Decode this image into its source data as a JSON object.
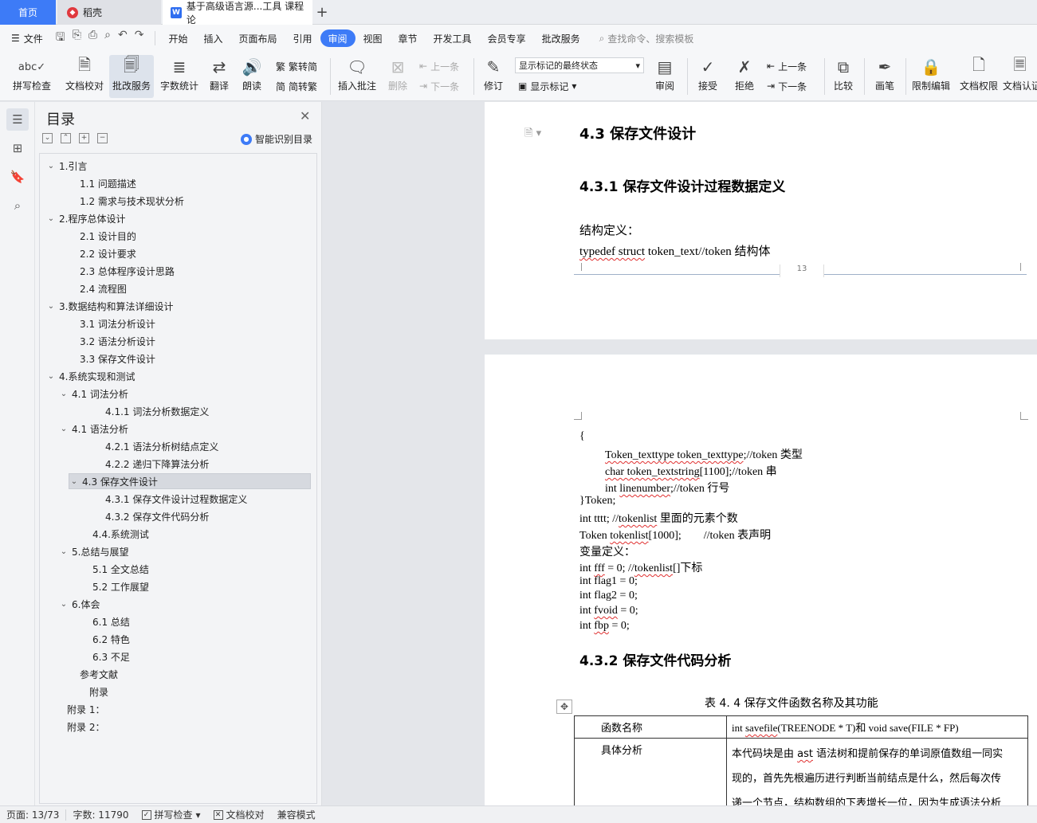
{
  "tabs": {
    "home": "首页",
    "daoke": "稻壳",
    "doc": "基于高级语言源...工具 课程论",
    "new": "+"
  },
  "menu": {
    "file": "文件",
    "items": [
      "开始",
      "插入",
      "页面布局",
      "引用",
      "审阅",
      "视图",
      "章节",
      "开发工具",
      "会员专享",
      "批改服务"
    ],
    "active": "审阅",
    "search": "查找命令、搜索模板"
  },
  "ribbon": {
    "spell": "拼写检查",
    "proof": "文档校对",
    "review_service": "批改服务",
    "wordcount": "字数统计",
    "translate": "翻译",
    "read": "朗读",
    "trad": "繁转简",
    "simp": "简转繁",
    "insert_comment": "插入批注",
    "delete": "删除",
    "prev1": "上一条",
    "next1": "下一条",
    "track": "修订",
    "markup_state": "显示标记的最终状态",
    "show_markup": "显示标记",
    "review_pane": "审阅",
    "accept": "接受",
    "reject": "拒绝",
    "prev2": "上一条",
    "next2": "下一条",
    "compare": "比较",
    "pen": "画笔",
    "restrict": "限制编辑",
    "perm": "文档权限",
    "cert": "文档认证"
  },
  "toc": {
    "title": "目录",
    "smart": "智能识别目录",
    "items": [
      "1.引言",
      "1.1 问题描述",
      "1.2 需求与技术现状分析",
      "2.程序总体设计",
      "2.1 设计目的",
      "2.2 设计要求",
      "2.3 总体程序设计思路",
      "2.4 流程图",
      "3.数据结构和算法详细设计",
      "3.1 词法分析设计",
      "3.2 语法分析设计",
      "3.3 保存文件设计",
      "4.系统实现和测试",
      "4.1 词法分析",
      "4.1.1 词法分析数据定义",
      "4.1 语法分析",
      "4.2.1 语法分析树结点定义",
      "4.2.2 递归下降算法分析",
      "4.3 保存文件设计",
      "4.3.1 保存文件设计过程数据定义",
      "4.3.2 保存文件代码分析",
      "4.4.系统测试",
      "5.总结与展望",
      "5.1 全文总结",
      "5.2 工作展望",
      "6.体会",
      "6.1 总结",
      "6.2 特色",
      "6.3 不足",
      "参考文献",
      "附录",
      "附录 1：",
      "附录 2："
    ]
  },
  "page1": {
    "h3": "4.3 保存文件设计",
    "h4": "4.3.1 保存文件设计过程数据定义",
    "struct_label": "结构定义：",
    "typedef_a": "typedef struct",
    "typedef_b": " token_text//token 结构体",
    "page_number": "13"
  },
  "page2": {
    "l1": "{",
    "l2a": "Token_texttype token_texttype",
    "l2b": ";//token 类型",
    "l3a": "char token_textstring",
    "l3b": "[1100];//token 串",
    "l4a": "int ",
    "l4b": "linenumber",
    "l4c": ";//token 行号",
    "l5": "}Token;",
    "l6a": "int tttt; //",
    "l6b": "tokenlist",
    "l6c": " 里面的元素个数",
    "l7a": "Token ",
    "l7b": "tokenlist",
    "l7c": "[1000];        //token 表声明",
    "l8": "变量定义：",
    "l9a": "int ",
    "l9b": "fff",
    "l9c": " = 0; //",
    "l9d": "tokenlist",
    "l9e": "[]下标",
    "l10": "int flag1 = 0;",
    "l11": "int flag2 = 0;",
    "l12a": "int ",
    "l12b": "fvoid",
    "l12c": " = 0;",
    "l13a": "int ",
    "l13b": "fbp",
    "l13c": " = 0;",
    "h4": "4.3.2 保存文件代码分析",
    "caption": "表 4. 4 保存文件函数名称及其功能",
    "table": {
      "r1c1": "函数名称",
      "r1c2a": "int ",
      "r1c2b": "savefile",
      "r1c2c": "(TREENODE * T)和 void save(FILE * FP)",
      "r2c1": "具体分析",
      "r2c2_l1a": "本代码块是由 ",
      "r2c2_l1b": "ast",
      "r2c2_l1c": " 语法树和提前保存的单词原值数组一同实",
      "r2c2_l2": "现的，首先先根遍历进行判断当前结点是什么，然后每次传",
      "r2c2_l3": "递一个节点，结构数组的下表增长一位，因为生成语法分析"
    }
  },
  "status": {
    "page": "页面: 13/73",
    "words": "字数: 11790",
    "spell": "拼写检查",
    "proof": "文档校对",
    "compat": "兼容模式"
  }
}
